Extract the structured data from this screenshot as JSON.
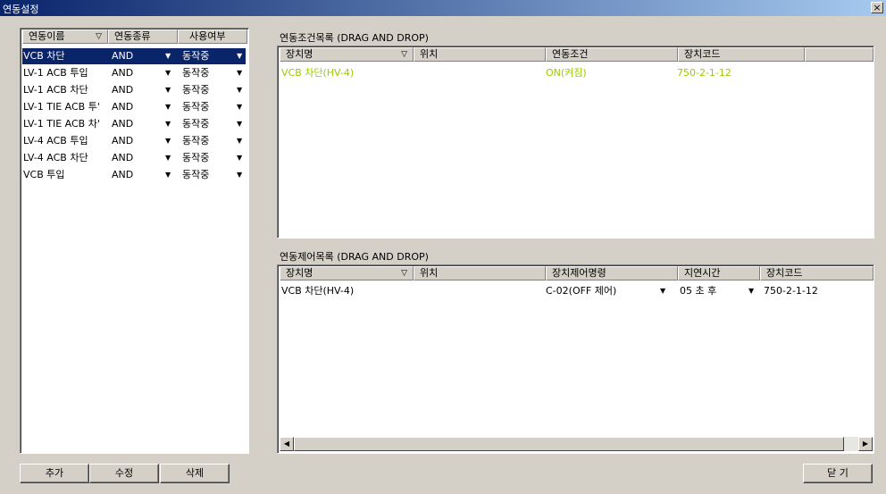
{
  "window": {
    "title": "연동설정",
    "close_glyph": "×"
  },
  "left_list": {
    "headers": {
      "name": "연동이름",
      "type": "연동종류",
      "usage": "사용여부",
      "sort_glyph": "▽"
    },
    "rows": [
      {
        "name": "VCB 차단",
        "type": "AND",
        "usage": "동작중",
        "selected": true
      },
      {
        "name": "LV-1 ACB 투입",
        "type": "AND",
        "usage": "동작중"
      },
      {
        "name": "LV-1 ACB 차단",
        "type": "AND",
        "usage": "동작중"
      },
      {
        "name": "LV-1 TIE ACB 투'",
        "type": "AND",
        "usage": "동작중"
      },
      {
        "name": "LV-1 TIE ACB 차'",
        "type": "AND",
        "usage": "동작중"
      },
      {
        "name": "LV-4 ACB 투입",
        "type": "AND",
        "usage": "동작중"
      },
      {
        "name": "LV-4 ACB 차단",
        "type": "AND",
        "usage": "동작중"
      },
      {
        "name": "VCB 투입",
        "type": "AND",
        "usage": "동작중"
      }
    ]
  },
  "conditions": {
    "label": "연동조건목록 (DRAG AND DROP)",
    "headers": {
      "device": "장치명",
      "location": "위치",
      "condition": "연동조건",
      "code": "장치코드",
      "sort_glyph": "▽"
    },
    "rows": [
      {
        "device": "VCB 차단(HV-4)",
        "location": "",
        "condition": "ON(켜짐)",
        "code": "750-2-1-12"
      }
    ]
  },
  "controls": {
    "label": "연동제어목록 (DRAG AND DROP)",
    "headers": {
      "device": "장치명",
      "location": "위치",
      "command": "장치제어명령",
      "delay": "지연시간",
      "code": "장치코드",
      "sort_glyph": "▽"
    },
    "rows": [
      {
        "device": "VCB 차단(HV-4)",
        "location": "",
        "command": "C-02(OFF 제어)",
        "delay": "05 초 후",
        "code": "750-2-1-12"
      }
    ]
  },
  "buttons": {
    "add": "추가",
    "edit": "수정",
    "delete": "삭제",
    "close": "닫 기"
  },
  "colors": {
    "selection": "#0a246a",
    "active_condition": "#99cc00"
  }
}
